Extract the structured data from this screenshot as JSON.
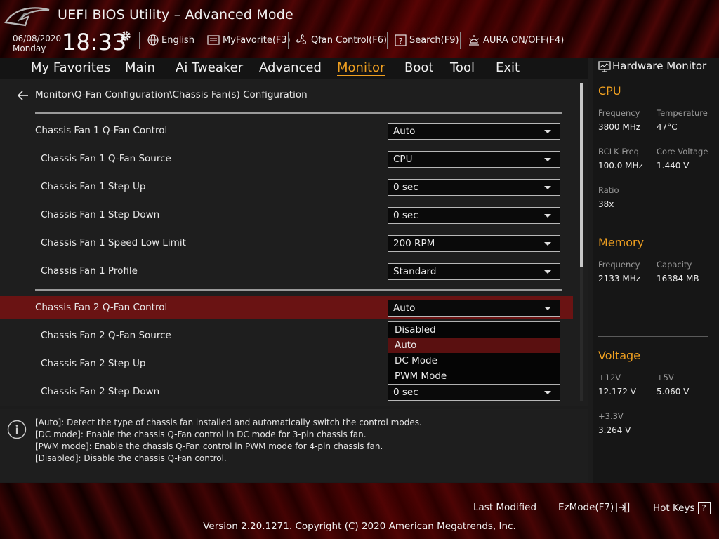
{
  "header": {
    "title": "UEFI BIOS Utility – Advanced Mode",
    "date": "06/08/2020",
    "day": "Monday",
    "time": "18:33",
    "language": "English",
    "my_favorite": "MyFavorite(F3)",
    "qfan": "Qfan Control(F6)",
    "search": "Search(F9)",
    "aura": "AURA ON/OFF(F4)"
  },
  "nav": {
    "tabs": [
      "My Favorites",
      "Main",
      "Ai Tweaker",
      "Advanced",
      "Monitor",
      "Boot",
      "Tool",
      "Exit"
    ],
    "active": "Monitor"
  },
  "main": {
    "breadcrumb": "Monitor\\Q-Fan Configuration\\Chassis Fan(s) Configuration",
    "rows": [
      {
        "label": "Chassis Fan 1 Q-Fan Control",
        "value": "Auto"
      },
      {
        "label": "Chassis Fan 1 Q-Fan Source",
        "value": "CPU"
      },
      {
        "label": "Chassis Fan 1 Step Up",
        "value": "0 sec"
      },
      {
        "label": "Chassis Fan 1 Step Down",
        "value": "0 sec"
      },
      {
        "label": "Chassis Fan 1 Speed Low Limit",
        "value": "200 RPM"
      },
      {
        "label": "Chassis Fan 1 Profile",
        "value": "Standard"
      },
      {
        "label": "Chassis Fan 2 Q-Fan Control",
        "value": "Auto"
      },
      {
        "label": "Chassis Fan 2 Q-Fan Source",
        "value": ""
      },
      {
        "label": "Chassis Fan 2 Step Up",
        "value": ""
      },
      {
        "label": "Chassis Fan 2 Step Down",
        "value": "0 sec"
      }
    ],
    "popup_options": [
      "Disabled",
      "Auto",
      "DC Mode",
      "PWM Mode"
    ],
    "popup_selected": "Auto"
  },
  "help": {
    "lines": [
      "[Auto]: Detect the type of chassis fan installed and automatically switch the control modes.",
      "[DC mode]: Enable the chassis Q-Fan control in DC mode for 3-pin chassis fan.",
      "[PWM mode]: Enable the chassis Q-Fan control in PWM mode for 4-pin chassis fan.",
      "[Disabled]: Disable the chassis Q-Fan control."
    ]
  },
  "hw": {
    "title": "Hardware Monitor",
    "cpu": {
      "heading": "CPU",
      "freq_label": "Frequency",
      "freq": "3800 MHz",
      "temp_label": "Temperature",
      "temp": "47°C",
      "bclk_label": "BCLK Freq",
      "bclk": "100.0 MHz",
      "vcore_label": "Core Voltage",
      "vcore": "1.440 V",
      "ratio_label": "Ratio",
      "ratio": "38x"
    },
    "memory": {
      "heading": "Memory",
      "freq_label": "Frequency",
      "freq": "2133 MHz",
      "cap_label": "Capacity",
      "cap": "16384 MB"
    },
    "voltage": {
      "heading": "Voltage",
      "v12_label": "+12V",
      "v12": "12.172 V",
      "v5_label": "+5V",
      "v5": "5.060 V",
      "v33_label": "+3.3V",
      "v33": "3.264 V"
    }
  },
  "footer": {
    "last_modified": "Last Modified",
    "ezmode": "EzMode(F7)",
    "hotkeys": "Hot Keys",
    "hotkeys_key": "?",
    "version": "Version 2.20.1271. Copyright (C) 2020 American Megatrends, Inc."
  },
  "colors": {
    "accent": "#f0a020",
    "selected_row": "#6a1313",
    "header_red": "#3a0404"
  }
}
